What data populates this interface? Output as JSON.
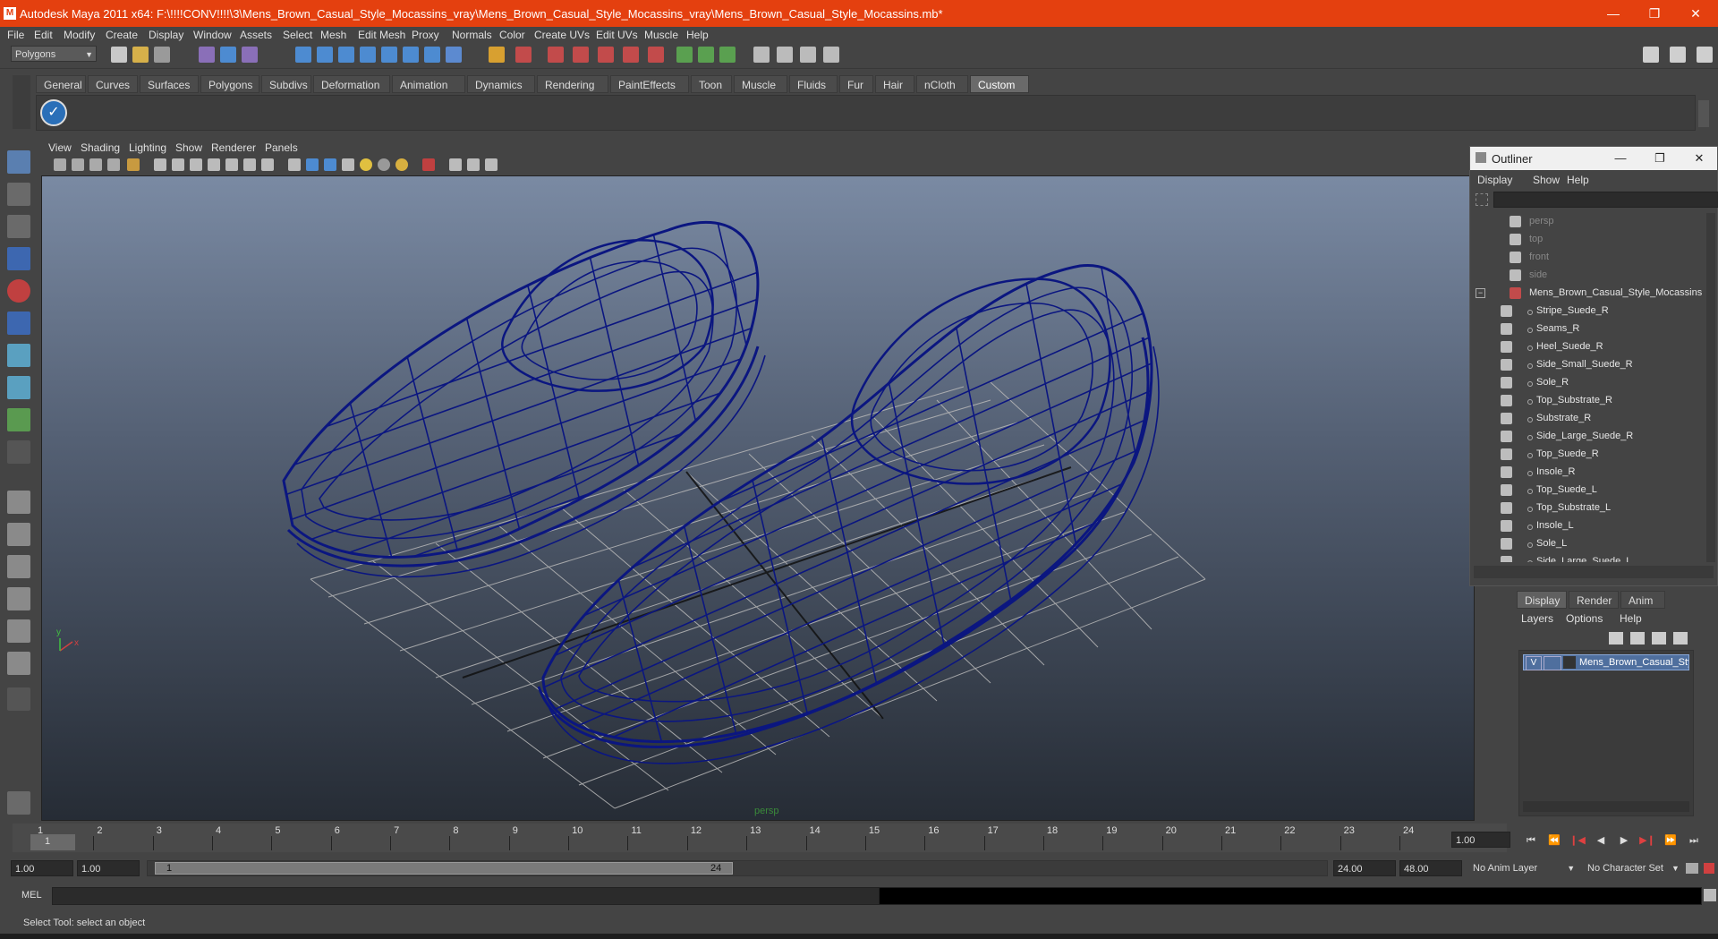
{
  "window": {
    "title": "Autodesk Maya 2011 x64: F:\\!!!!CONV!!!!\\3\\Mens_Brown_Casual_Style_Mocassins_vray\\Mens_Brown_Casual_Style_Mocassins_vray\\Mens_Brown_Casual_Style_Mocassins.mb*",
    "minimize": "—",
    "maximize": "❐",
    "close": "✕",
    "accent": "#e4400f"
  },
  "menubar": [
    "File",
    "Edit",
    "Modify",
    "Create",
    "Display",
    "Window",
    "Assets",
    "Select",
    "Mesh",
    "Edit Mesh",
    "Proxy",
    "Normals",
    "Color",
    "Create UVs",
    "Edit UVs",
    "Muscle",
    "Help"
  ],
  "statusline": {
    "mode": "Polygons"
  },
  "shelf": {
    "tabs": [
      "General",
      "Curves",
      "Surfaces",
      "Polygons",
      "Subdivs",
      "Deformation",
      "Animation",
      "Dynamics",
      "Rendering",
      "PaintEffects",
      "Toon",
      "Muscle",
      "Fluids",
      "Fur",
      "Hair",
      "nCloth",
      "Custom"
    ],
    "active": "Custom",
    "icon": "check-shelf-icon"
  },
  "viewport": {
    "menu": [
      "View",
      "Shading",
      "Lighting",
      "Show",
      "Renderer",
      "Panels"
    ],
    "camera_label": "persp",
    "axis": {
      "x": "x",
      "y": "y"
    },
    "wire_color": "#0b1680"
  },
  "outliner": {
    "title": "Outliner",
    "menu": [
      "Display",
      "Show",
      "Help"
    ],
    "items": [
      {
        "label": "persp",
        "dim": true,
        "indent": 0
      },
      {
        "label": "top",
        "dim": true,
        "indent": 0
      },
      {
        "label": "front",
        "dim": true,
        "indent": 0
      },
      {
        "label": "side",
        "dim": true,
        "indent": 0
      },
      {
        "label": "Mens_Brown_Casual_Style_Mocassins",
        "dim": false,
        "indent": 0,
        "group": true
      },
      {
        "label": "Stripe_Suede_R",
        "dim": false,
        "indent": 1
      },
      {
        "label": "Seams_R",
        "dim": false,
        "indent": 1
      },
      {
        "label": "Heel_Suede_R",
        "dim": false,
        "indent": 1
      },
      {
        "label": "Side_Small_Suede_R",
        "dim": false,
        "indent": 1
      },
      {
        "label": "Sole_R",
        "dim": false,
        "indent": 1
      },
      {
        "label": "Top_Substrate_R",
        "dim": false,
        "indent": 1
      },
      {
        "label": "Substrate_R",
        "dim": false,
        "indent": 1
      },
      {
        "label": "Side_Large_Suede_R",
        "dim": false,
        "indent": 1
      },
      {
        "label": "Top_Suede_R",
        "dim": false,
        "indent": 1
      },
      {
        "label": "Insole_R",
        "dim": false,
        "indent": 1
      },
      {
        "label": "Top_Suede_L",
        "dim": false,
        "indent": 1
      },
      {
        "label": "Top_Substrate_L",
        "dim": false,
        "indent": 1
      },
      {
        "label": "Insole_L",
        "dim": false,
        "indent": 1
      },
      {
        "label": "Sole_L",
        "dim": false,
        "indent": 1
      },
      {
        "label": "Side_Large_Suede_L",
        "dim": false,
        "indent": 1
      }
    ]
  },
  "layers": {
    "tabs": [
      "Display",
      "Render",
      "Anim"
    ],
    "active": "Display",
    "menu": [
      "Layers",
      "Options",
      "Help"
    ],
    "row": {
      "visible": "V",
      "name": "Mens_Brown_Casual_Sty"
    }
  },
  "timeline": {
    "ticks": [
      "1",
      "2",
      "3",
      "4",
      "5",
      "6",
      "7",
      "8",
      "9",
      "10",
      "11",
      "12",
      "13",
      "14",
      "15",
      "16",
      "17",
      "18",
      "19",
      "20",
      "21",
      "22",
      "23",
      "24"
    ],
    "current_frame": "1",
    "current_time": "1.00",
    "playback": [
      "⏮",
      "⏪",
      "❙◀",
      "◀",
      "▶",
      "▶❙",
      "⏩",
      "⏭"
    ]
  },
  "range": {
    "start": "1.00",
    "playback_start": "1.00",
    "handle_start": "1",
    "handle_end": "24",
    "playback_end": "24.00",
    "end": "48.00",
    "anim_layer": "No Anim Layer",
    "char_set": "No Character Set"
  },
  "command": {
    "label": "MEL"
  },
  "help_line": "Select Tool: select an object"
}
